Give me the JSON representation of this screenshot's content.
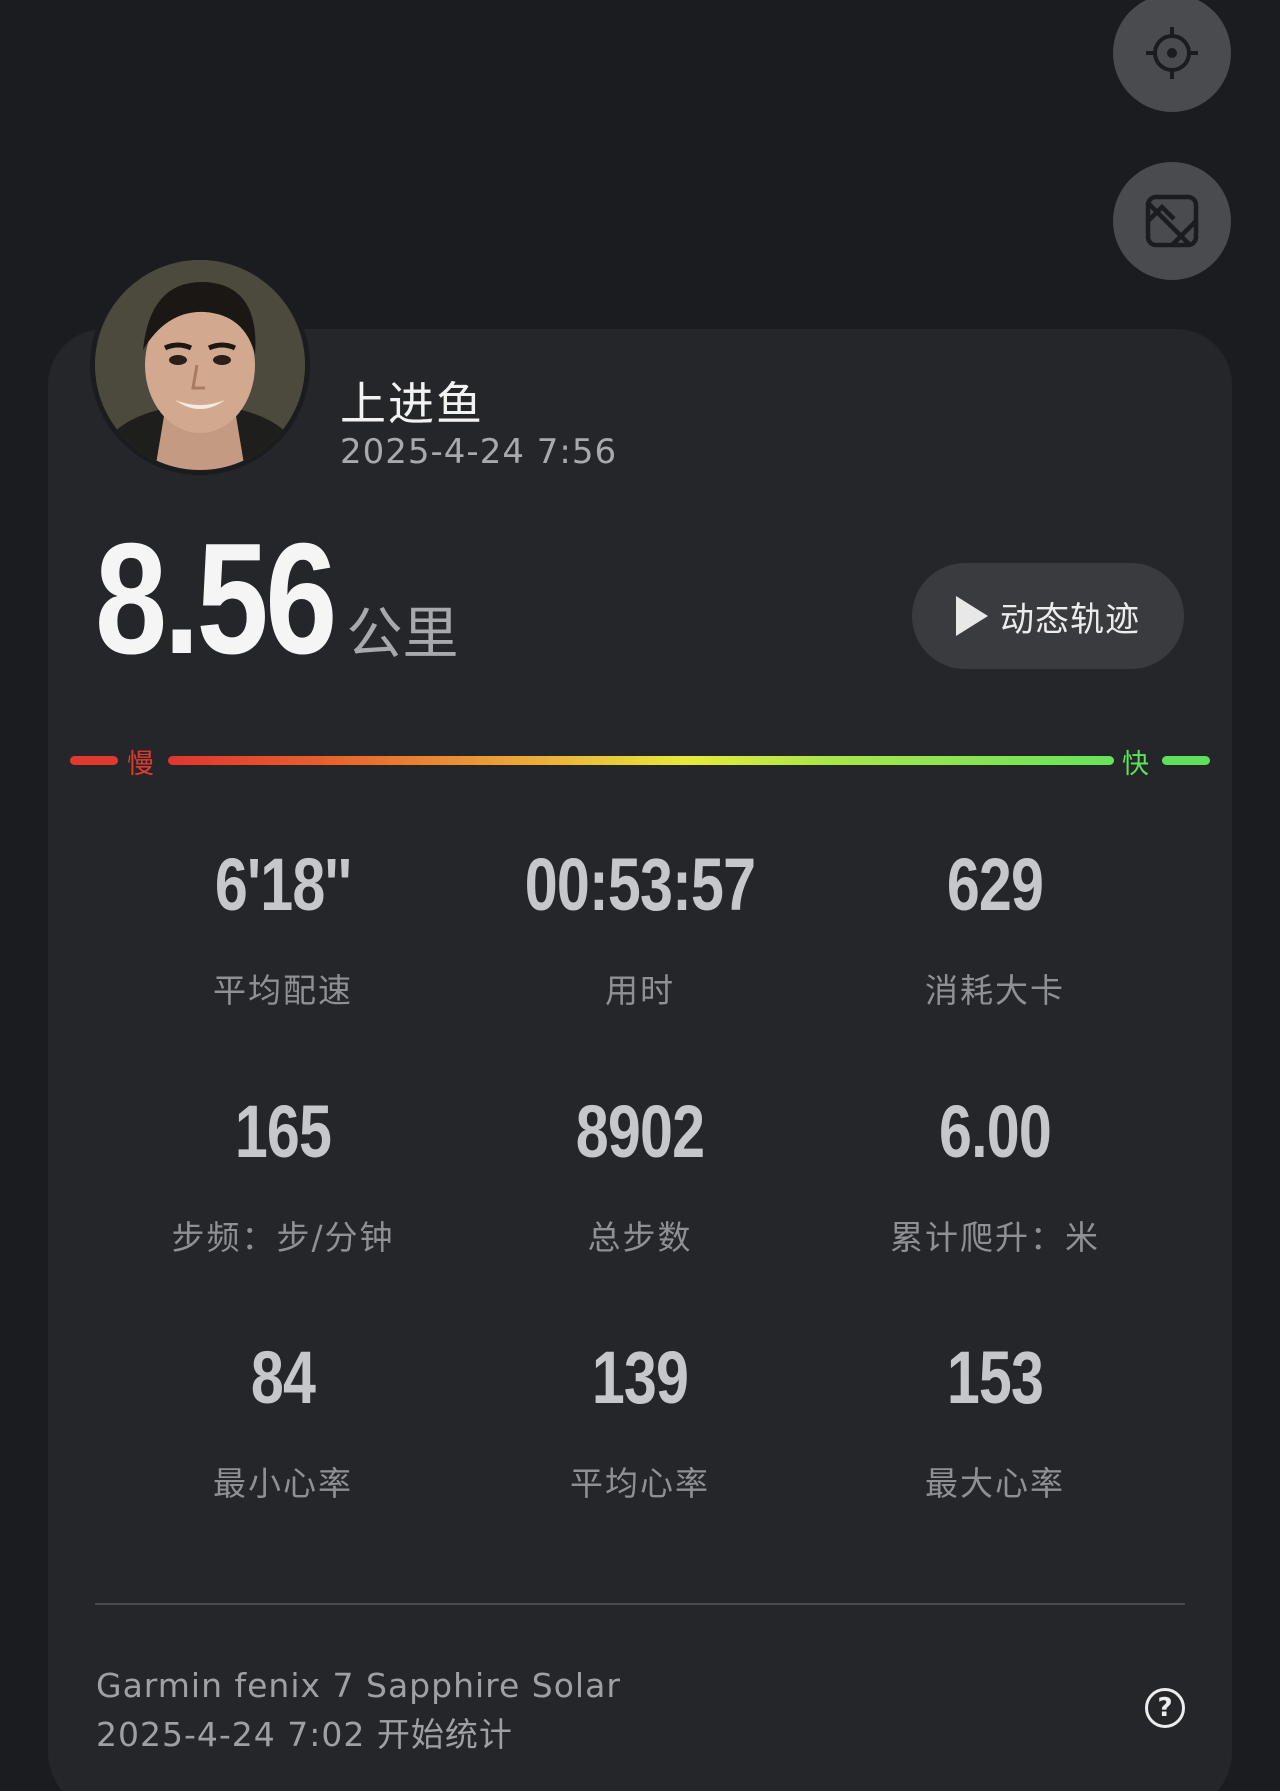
{
  "controls": {
    "locate_icon": "crosshair-icon",
    "map_icon": "map-toggle-icon"
  },
  "profile": {
    "name": "上进鱼",
    "time": "2025-4-24 7:56"
  },
  "distance": {
    "value": "8.56",
    "unit": "公里"
  },
  "replay_button": {
    "label": "动态轨迹",
    "icon": "play-icon"
  },
  "pace_bar": {
    "slow_label": "慢",
    "fast_label": "快",
    "colors": [
      "#e0352f",
      "#ecb03a",
      "#e6ea3a",
      "#66e35a"
    ]
  },
  "stats": [
    {
      "value": "6'18''",
      "label": "平均配速"
    },
    {
      "value": "00:53:57",
      "label": "用时"
    },
    {
      "value": "629",
      "label": "消耗大卡"
    },
    {
      "value": "165",
      "label": "步频：步/分钟"
    },
    {
      "value": "8902",
      "label": "总步数"
    },
    {
      "value": "6.00",
      "label": "累计爬升：米"
    },
    {
      "value": "84",
      "label": "最小心率"
    },
    {
      "value": "139",
      "label": "平均心率"
    },
    {
      "value": "153",
      "label": "最大心率"
    }
  ],
  "footer": {
    "device": "Garmin fenix 7 Sapphire Solar",
    "start": "2025-4-24 7:02 开始统计",
    "help_icon": "help-icon",
    "help_glyph": "?"
  }
}
